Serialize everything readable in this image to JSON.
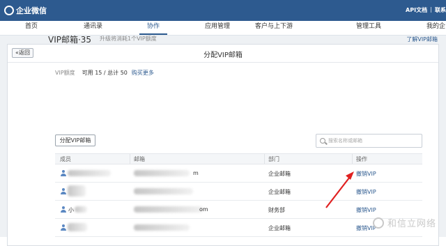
{
  "topbar": {
    "logo_text": "企业微信",
    "links": [
      "API文档",
      "|",
      "联系"
    ]
  },
  "nav": {
    "items": [
      "首页",
      "通讯录",
      "协作",
      "应用管理",
      "客户与上下游",
      "管理工具",
      "我的企"
    ],
    "active": "协作"
  },
  "panel": {
    "back_label": "«返回",
    "title": "分配VIP邮箱"
  },
  "vip": {
    "title": "VIP邮箱·35",
    "subtitle": "升级将消耗1个VIP额度",
    "learn_link": "了解VIP邮箱",
    "quota_label": "VIP额度",
    "quota_value": "可用 15 / 总计 50",
    "buy_link": "购买更多"
  },
  "toolbar": {
    "assign_label": "分配VIP邮箱",
    "search_placeholder": "搜索名称或邮箱"
  },
  "table": {
    "headers": [
      "成员",
      "邮箱",
      "部门",
      "操作"
    ],
    "rows": [
      {
        "name": "",
        "email": "m",
        "dept": "企业邮箱",
        "action": "撤销VIP"
      },
      {
        "name": "",
        "email": "",
        "dept": "企业邮箱",
        "action": "撤销VIP"
      },
      {
        "name": "小",
        "email": "om",
        "dept": "财务部",
        "action": "撤销VIP"
      },
      {
        "name": "",
        "email": "",
        "dept": "企业邮箱",
        "action": "撤销VIP"
      }
    ]
  },
  "colors": {
    "brand": "#2d5a8f",
    "annotation_arrow": "#e02020"
  },
  "watermark": {
    "text": "和信立网络"
  }
}
